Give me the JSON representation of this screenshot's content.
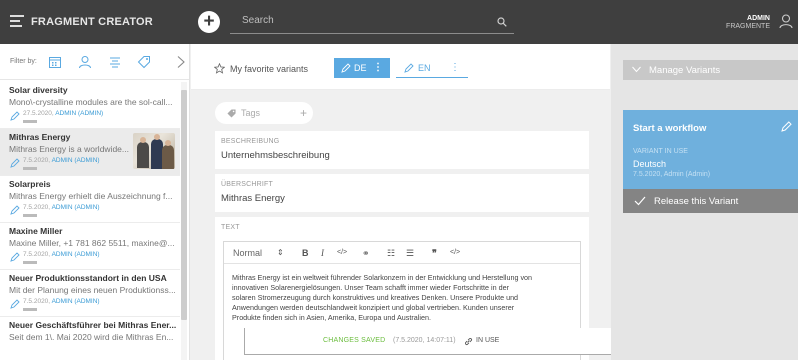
{
  "header": {
    "app_title": "FRAGMENT CREATOR",
    "search_placeholder": "Search",
    "user_name": "ADMIN",
    "user_role": "FRAGMENTE"
  },
  "sidebar": {
    "filter_label": "Filter by:",
    "items": [
      {
        "title": "Solar diversity",
        "desc": "Mono\\-crystalline modules are the sol-call...",
        "date": "27.5.2020,",
        "user": "ADMIN (ADMIN)"
      },
      {
        "title": "Mithras Energy",
        "desc": "Mithras Energy is a worldwide...",
        "date": "7.5.2020,",
        "user": "ADMIN (ADMIN)"
      },
      {
        "title": "Solarpreis",
        "desc": "Mithras Energy erhielt die Auszeichnung f...",
        "date": "7.5.2020,",
        "user": "ADMIN (ADMIN)"
      },
      {
        "title": "Maxine Miller",
        "desc": "Maxine Miller, +1 781 862 5511, maxine@...",
        "date": "7.5.2020,",
        "user": "ADMIN (ADMIN)"
      },
      {
        "title": "Neuer Produktionsstandort in den USA",
        "desc": "Mit der Planung eines neuen Produktionss...",
        "date": "7.5.2020,",
        "user": "ADMIN (ADMIN)"
      },
      {
        "title": "Neuer Geschäftsführer bei Mithras Ener...",
        "desc": "Seit dem 1\\. Mai 2020 wird die Mithras En...",
        "date": "",
        "user": ""
      }
    ]
  },
  "toolbar": {
    "favorite_label": "My favorite variants",
    "lang_active": "DE",
    "lang_other": "EN"
  },
  "editor": {
    "tags_placeholder": "Tags",
    "beschreibung_label": "BESCHREIBUNG",
    "beschreibung_value": "Unternehmsbeschreibung",
    "ueberschrift_label": "ÜBERSCHRIFT",
    "ueberschrift_value": "Mithras Energy",
    "text_label": "TEXT",
    "format_select": "Normal",
    "body_lines": [
      "Mithras Energy ist ein weltweit führender Solarkonzern in der Entwicklung und Herstellung von",
      "innovativen Solarenergielösungen. Unser Team schafft immer wieder Fortschritte in der",
      "solaren Stromerzeugung durch konstruktives und kreatives Denken. Unsere Produkte und",
      "Anwendungen werden deutschlandweit konzipiert und global vertrieben. Kunden unserer",
      "Produkte finden sich in Asien, Amerika, Europa und Australien."
    ]
  },
  "status": {
    "saved_label": "CHANGES SAVED",
    "timestamp": "(7.5.2020, 14:07:11)",
    "in_use_label": "IN USE"
  },
  "right_panel": {
    "manage_label": "Manage Variants",
    "workflow_title": "Start a workflow",
    "variant_in_use_label": "VARIANT IN USE",
    "language": "Deutsch",
    "variant_date": "7.5.2020, Admin (Admin)",
    "release_label": "Release this Variant"
  },
  "colors": {
    "header_bg": "#3f3f3f",
    "accent_blue": "#5aa9e1",
    "workflow_blue": "#6fb0dd",
    "saved_green": "#6bbd3e",
    "release_gray": "#848484"
  }
}
